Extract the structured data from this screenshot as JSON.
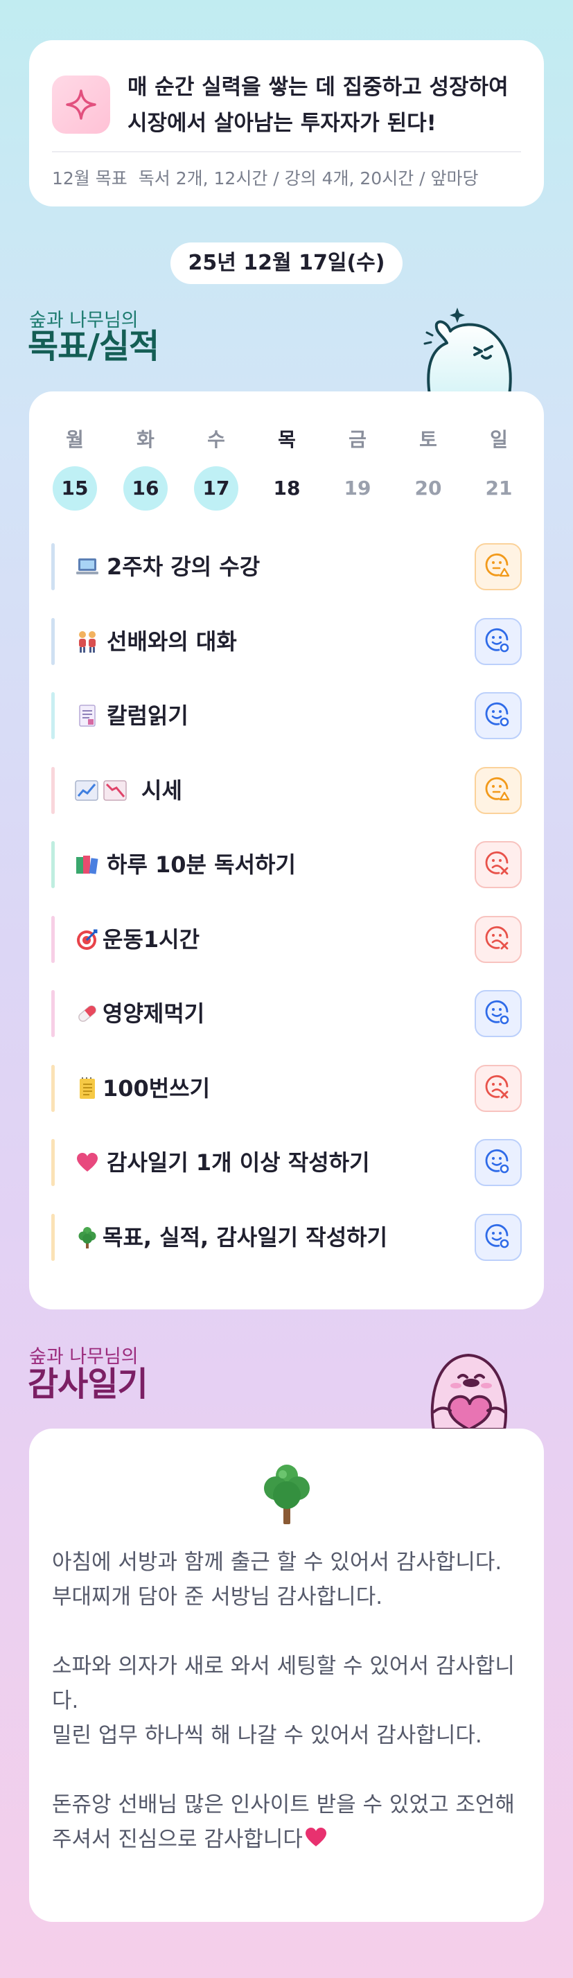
{
  "motto": {
    "icon": "sparkle-icon",
    "text": "매 순간 실력을 쌓는 데 집중하고 성장하여 시장에서 살아남는 투자자가 된다!",
    "goal_label": "12월 목표",
    "goal_text": "독서 2개, 12시간 / 강의 4개, 20시간 / 앞마당"
  },
  "date": "25년 12월 17일(수)",
  "goals_section": {
    "subtitle": "숲과 나무님의",
    "title": "목표/실적"
  },
  "week": {
    "days": [
      {
        "weekday": "월",
        "date": "15",
        "state": "done"
      },
      {
        "weekday": "화",
        "date": "16",
        "state": "done"
      },
      {
        "weekday": "수",
        "date": "17",
        "state": "done"
      },
      {
        "weekday": "목",
        "date": "18",
        "state": "today"
      },
      {
        "weekday": "금",
        "date": "19",
        "state": "future"
      },
      {
        "weekday": "토",
        "date": "20",
        "state": "future"
      },
      {
        "weekday": "일",
        "date": "21",
        "state": "future"
      }
    ]
  },
  "tasks": [
    {
      "label": "2주차 강의 수강",
      "icon": "laptop-icon",
      "status": "mid",
      "bar_color": "#cfe0f2"
    },
    {
      "label": "선배와의 대화",
      "icon": "people-icon",
      "status": "good",
      "bar_color": "#cfe0f2"
    },
    {
      "label": "칼럼읽기",
      "icon": "document-icon",
      "status": "good",
      "bar_color": "#c9eff2"
    },
    {
      "label": "시세",
      "icon": "chart-icon",
      "status": "mid",
      "bar_color": "#f9d6db"
    },
    {
      "label": "하루 10분 독서하기",
      "icon": "books-icon",
      "status": "bad",
      "bar_color": "#bfeee0"
    },
    {
      "label": "운동1시간",
      "icon": "target-icon",
      "status": "bad",
      "bar_color": "#f7cfe6"
    },
    {
      "label": "영양제먹기",
      "icon": "pill-icon",
      "status": "good",
      "bar_color": "#f7cfe6"
    },
    {
      "label": "100번쓰기",
      "icon": "notepad-icon",
      "status": "bad",
      "bar_color": "#fbe2b6"
    },
    {
      "label": "감사일기 1개 이상 작성하기",
      "icon": "heart-icon",
      "status": "good",
      "bar_color": "#fbe2b6"
    },
    {
      "label": "목표, 실적, 감사일기 작성하기",
      "icon": "tree-icon",
      "status": "good",
      "bar_color": "#fbe2b6"
    }
  ],
  "thanks_section": {
    "subtitle": "숲과 나무님의",
    "title": "감사일기"
  },
  "thanks": {
    "lines_1": [
      "아침에 서방과 함께 출근 할 수 있어서 감사합니다.",
      "부대찌개 담아 준 서방님 감사합니다."
    ],
    "lines_2": [
      "소파와 의자가 새로 와서 세팅할 수 있어서 감사합니다.",
      "밀린 업무 하나씩 해 나갈 수 있어서 감사합니다."
    ],
    "line_3": "돈쥬앙 선배님 많은 인사이트 받을 수 있었고 조언해주셔서 진심으로 감사합니다"
  },
  "colors": {
    "done_day": "#bff0f5",
    "status_good": "#2f6be8",
    "status_mid": "#f29a1b",
    "status_bad": "#e8524a",
    "goals_title": "#145e55",
    "thanks_title": "#7b1f64"
  }
}
